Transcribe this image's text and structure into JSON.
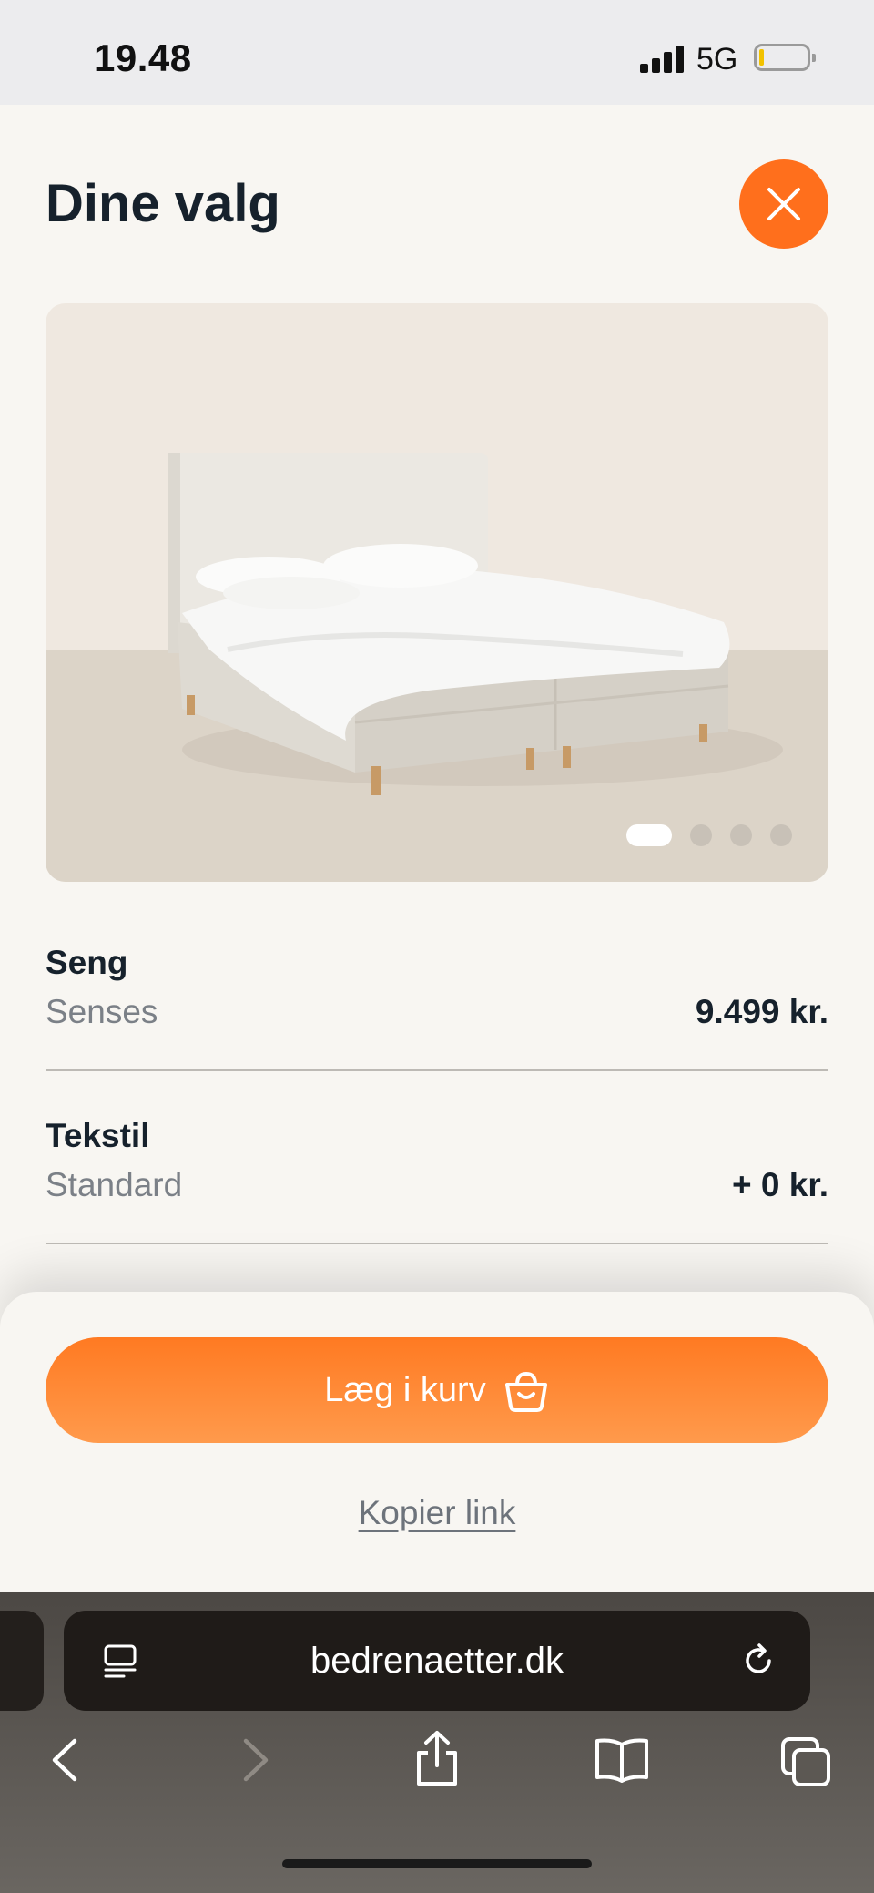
{
  "status_bar": {
    "time": "19.48",
    "network": "5G",
    "signal_icon": "cellular-signal-icon",
    "battery_icon": "battery-low-icon"
  },
  "header": {
    "title": "Dine valg",
    "close_icon": "close-icon"
  },
  "gallery": {
    "image": "bed-product-photo",
    "pages": 4,
    "active_page": 1
  },
  "selections": [
    {
      "label": "Seng",
      "value": "Senses",
      "price": "9.499 kr."
    },
    {
      "label": "Tekstil",
      "value": "Standard",
      "price": "+ 0 kr."
    }
  ],
  "actions": {
    "add_to_cart": "Læg i kurv",
    "cart_icon": "shopping-basket-icon",
    "copy_link": "Kopier link"
  },
  "browser": {
    "url": "bedrenaetter.dk",
    "reader_icon": "page-menu-icon",
    "reload_icon": "reload-icon"
  },
  "toolbar": [
    "back-icon",
    "forward-icon",
    "share-icon",
    "bookmarks-icon",
    "tabs-icon"
  ],
  "colors": {
    "accent": "#ff6f1c",
    "background": "#f8f6f2",
    "text": "#16212c",
    "muted": "#7b8087"
  }
}
